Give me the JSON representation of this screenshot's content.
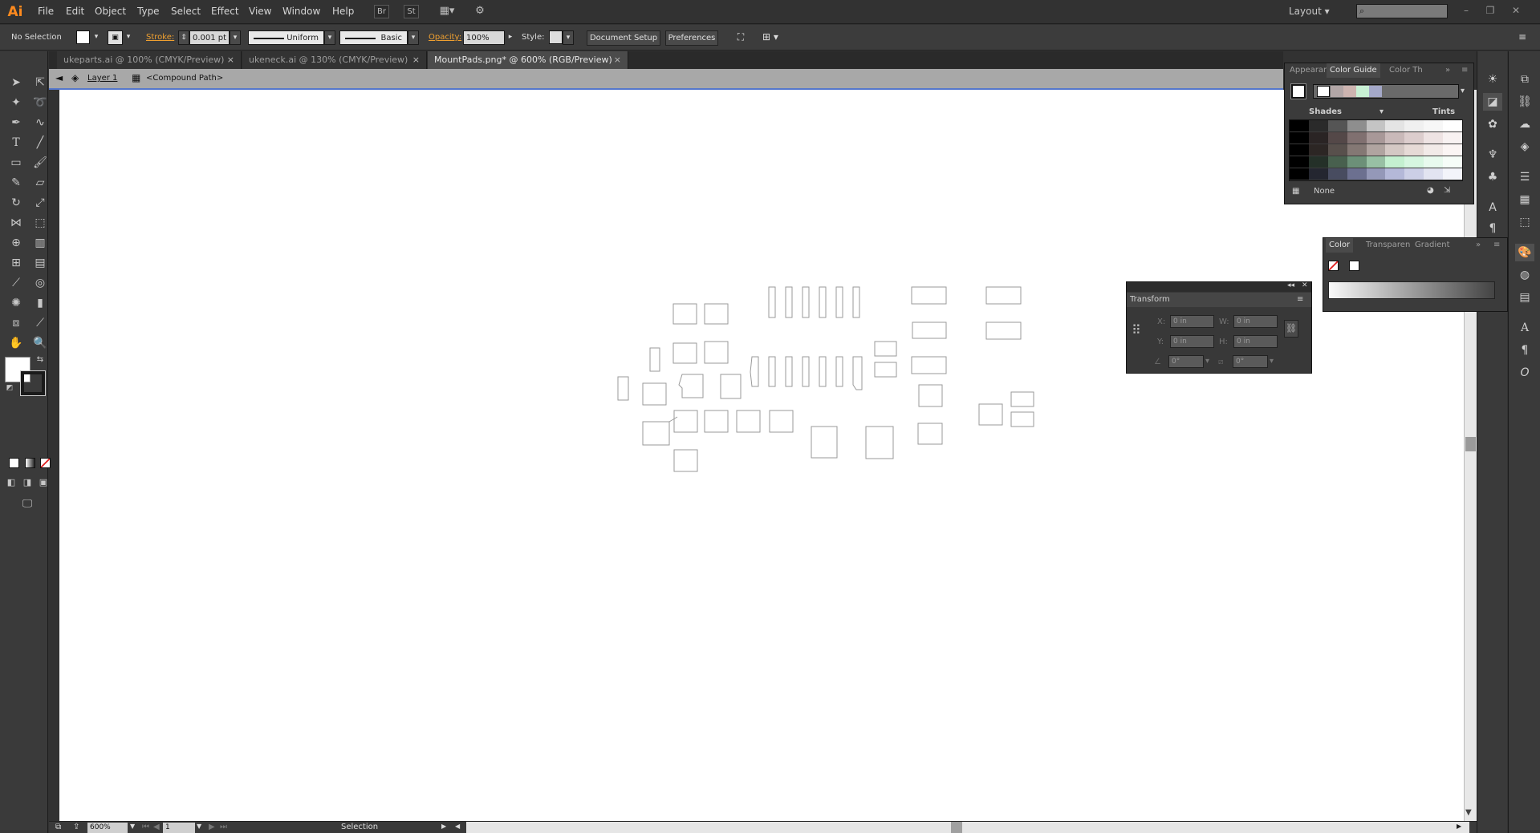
{
  "app": {
    "logo": "Ai"
  },
  "menu": [
    "File",
    "Edit",
    "Object",
    "Type",
    "Select",
    "Effect",
    "View",
    "Window",
    "Help"
  ],
  "menubar_icons": {
    "bridge": "Br",
    "stock": "St"
  },
  "workspace": {
    "label": "Layout ▾"
  },
  "control": {
    "selection": "No Selection",
    "stroke_label": "Stroke:",
    "stroke_value": "0.001 pt",
    "profile_label": "Uniform",
    "brush_label": "Basic",
    "opacity_label": "Opacity:",
    "opacity_value": "100%",
    "style_label": "Style:",
    "document_setup": "Document Setup",
    "preferences": "Preferences"
  },
  "tabs": [
    {
      "label": "ukeparts.ai @ 100% (CMYK/Preview)",
      "active": false
    },
    {
      "label": "ukeneck.ai @ 130% (CMYK/Preview)",
      "active": false
    },
    {
      "label": "MountPads.png* @ 600% (RGB/Preview)",
      "active": true
    }
  ],
  "breadcrumb": {
    "layer": "Layer 1",
    "path": "<Compound Path>"
  },
  "status": {
    "zoom": "600%",
    "artboard": "1",
    "tool": "Selection"
  },
  "color_guide": {
    "tabs": [
      "Appearar",
      "Color Guide",
      "Color Th"
    ],
    "shades_label": "Shades",
    "tints_label": "Tints",
    "none_label": "None",
    "harmony": [
      "#ffffff",
      "#b2a6a6",
      "#cdb4b0",
      "#c8f0d4",
      "#a4a8c8"
    ],
    "grid_rows": [
      [
        "#000000",
        "#2a2a2a",
        "#555555",
        "#8e8e8e",
        "#c4c4c4",
        "#e4e4e4",
        "#f0f0f0",
        "#f7f7f7",
        "#ffffff"
      ],
      [
        "#000000",
        "#2a2424",
        "#544848",
        "#807070",
        "#a89898",
        "#c9b9b9",
        "#dccdcd",
        "#eee3e3",
        "#f8f2f2"
      ],
      [
        "#000000",
        "#2c2624",
        "#58504c",
        "#847874",
        "#b0a4a0",
        "#d4c8c4",
        "#e6dad6",
        "#f2eae8",
        "#fbf5f4"
      ],
      [
        "#000000",
        "#243028",
        "#48604e",
        "#6c9078",
        "#98c0a4",
        "#c4f0d0",
        "#d6f6e0",
        "#e8faee",
        "#f6fdf8"
      ],
      [
        "#000000",
        "#242630",
        "#484c60",
        "#6c7090",
        "#9498b8",
        "#b4b8d8",
        "#cccfe6",
        "#e2e4f1",
        "#f3f4fa"
      ]
    ]
  },
  "color_panel": {
    "tabs": [
      "Color",
      "Transparen",
      "Gradient"
    ]
  },
  "transform": {
    "title": "Transform",
    "x_label": "X:",
    "x_value": "0 in",
    "y_label": "Y:",
    "y_value": "0 in",
    "w_label": "W:",
    "w_value": "0 in",
    "h_label": "H:",
    "h_value": "0 in",
    "rotate_value": "0°",
    "shear_value": "0°"
  }
}
